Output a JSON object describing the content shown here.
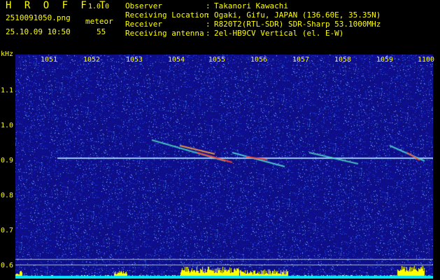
{
  "header": {
    "app_title": "H R O F F T",
    "version": "1.0.0",
    "filename": "2510091050.png",
    "datetime": "25.10.09 10:50",
    "mode": "meteor",
    "count": "55",
    "meta": [
      {
        "label": "Observer",
        "value": "Takanori Kawachi"
      },
      {
        "label": "Receiving Location",
        "value": "Ogaki, Gifu, JAPAN (136.60E, 35.35N)"
      },
      {
        "label": "Receiver",
        "value": "R820T2(RTL-SDR) SDR-Sharp 53.1000MHz"
      },
      {
        "label": "Receiving antenna",
        "value": "2el-HB9CV Vertical (el. E-W)"
      }
    ]
  },
  "axes": {
    "y_unit": "kHz",
    "y_ticks": [
      "1.1",
      "1.0",
      "0.9",
      "0.8",
      "0.7",
      "0.6"
    ],
    "x_ticks": [
      "1051",
      "1052",
      "1053",
      "1054",
      "1055",
      "1056",
      "1057",
      "1058",
      "1059",
      "1100"
    ]
  },
  "colors": {
    "text": "#ffff00",
    "background": "#000000",
    "waterfall_base": "#1a1aa0",
    "activity_bar": "#ffff00",
    "baseline": "#00e5ff"
  }
}
